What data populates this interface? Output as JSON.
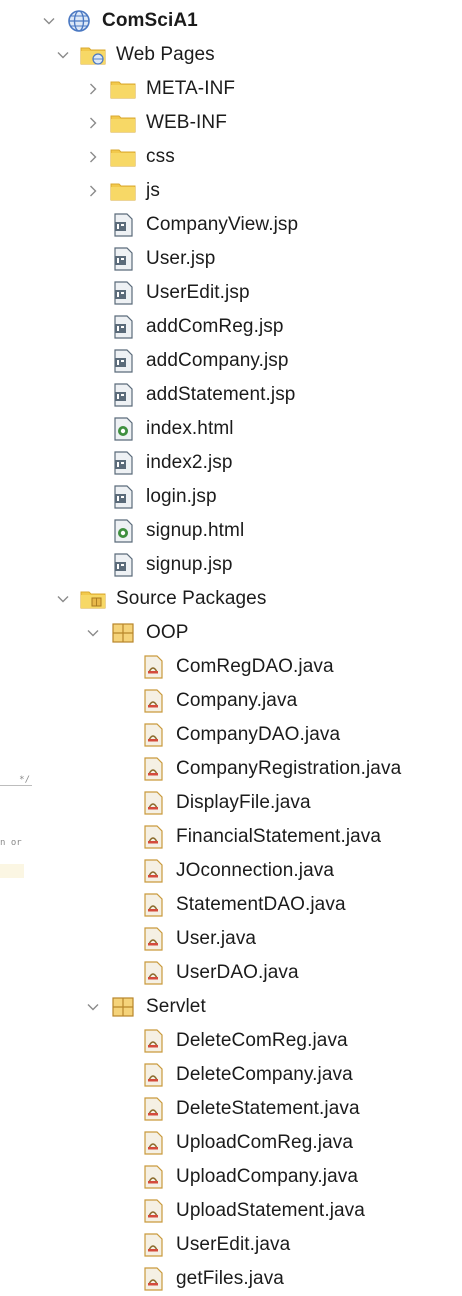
{
  "colors": {
    "folder": "#f2c94c",
    "folder_dark": "#d9a930",
    "package": "#e8b84a",
    "chevron": "#8a8a8a",
    "globe": "#4a78c2",
    "jsp_file": "#5b6b7a",
    "html_file": "#3f8f3f",
    "java_file": "#c99a3c"
  },
  "tree": {
    "project": {
      "label": "ComSciA1",
      "icon": "globe-icon",
      "expanded": true
    },
    "web_pages": {
      "label": "Web Pages",
      "icon": "web-pages-folder-icon",
      "expanded": true,
      "folders": [
        {
          "label": "META-INF",
          "icon": "folder-icon",
          "expanded": false
        },
        {
          "label": "WEB-INF",
          "icon": "folder-icon",
          "expanded": false
        },
        {
          "label": "css",
          "icon": "folder-icon",
          "expanded": false
        },
        {
          "label": "js",
          "icon": "folder-icon",
          "expanded": false
        }
      ],
      "files": [
        {
          "label": "CompanyView.jsp",
          "icon": "jsp-file-icon"
        },
        {
          "label": "User.jsp",
          "icon": "jsp-file-icon"
        },
        {
          "label": "UserEdit.jsp",
          "icon": "jsp-file-icon"
        },
        {
          "label": "addComReg.jsp",
          "icon": "jsp-file-icon"
        },
        {
          "label": "addCompany.jsp",
          "icon": "jsp-file-icon"
        },
        {
          "label": "addStatement.jsp",
          "icon": "jsp-file-icon"
        },
        {
          "label": "index.html",
          "icon": "html-file-icon"
        },
        {
          "label": "index2.jsp",
          "icon": "jsp-file-icon"
        },
        {
          "label": "login.jsp",
          "icon": "jsp-file-icon"
        },
        {
          "label": "signup.html",
          "icon": "html-file-icon"
        },
        {
          "label": "signup.jsp",
          "icon": "jsp-file-icon"
        }
      ]
    },
    "source_packages": {
      "label": "Source Packages",
      "icon": "source-packages-icon",
      "expanded": true,
      "packages": [
        {
          "label": "OOP",
          "icon": "package-icon",
          "expanded": true,
          "files": [
            "ComRegDAO.java",
            "Company.java",
            "CompanyDAO.java",
            "CompanyRegistration.java",
            "DisplayFile.java",
            "FinancialStatement.java",
            "JOconnection.java",
            "StatementDAO.java",
            "User.java",
            "UserDAO.java"
          ]
        },
        {
          "label": "Servlet",
          "icon": "package-icon",
          "expanded": true,
          "files": [
            "DeleteComReg.java",
            "DeleteCompany.java",
            "DeleteStatement.java",
            "UploadComReg.java",
            "UploadCompany.java",
            "UploadStatement.java",
            "UserEdit.java",
            "getFiles.java"
          ]
        }
      ]
    }
  },
  "editor_fragments": {
    "line1": "*/",
    "line2": "n or"
  }
}
